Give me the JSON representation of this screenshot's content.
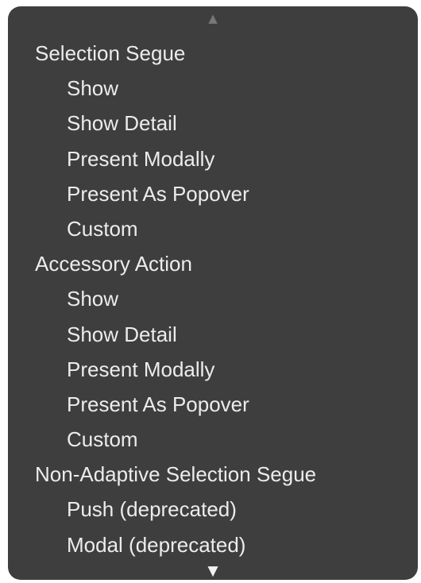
{
  "menu": {
    "scroll_up_icon": "triangle-up",
    "scroll_down_icon": "triangle-down",
    "colors": {
      "background": "#3e3e3e",
      "text": "#ececec",
      "scroll_up": "#777777",
      "scroll_down": "#f2f2f2"
    },
    "items": [
      {
        "type": "header",
        "label": "Selection Segue"
      },
      {
        "type": "option",
        "label": "Show"
      },
      {
        "type": "option",
        "label": "Show Detail"
      },
      {
        "type": "option",
        "label": "Present Modally"
      },
      {
        "type": "option",
        "label": "Present As Popover"
      },
      {
        "type": "option",
        "label": "Custom"
      },
      {
        "type": "header",
        "label": "Accessory Action"
      },
      {
        "type": "option",
        "label": "Show"
      },
      {
        "type": "option",
        "label": "Show Detail"
      },
      {
        "type": "option",
        "label": "Present Modally"
      },
      {
        "type": "option",
        "label": "Present As Popover"
      },
      {
        "type": "option",
        "label": "Custom"
      },
      {
        "type": "header",
        "label": "Non-Adaptive Selection Segue"
      },
      {
        "type": "option",
        "label": "Push (deprecated)"
      },
      {
        "type": "option",
        "label": "Modal (deprecated)"
      }
    ]
  }
}
